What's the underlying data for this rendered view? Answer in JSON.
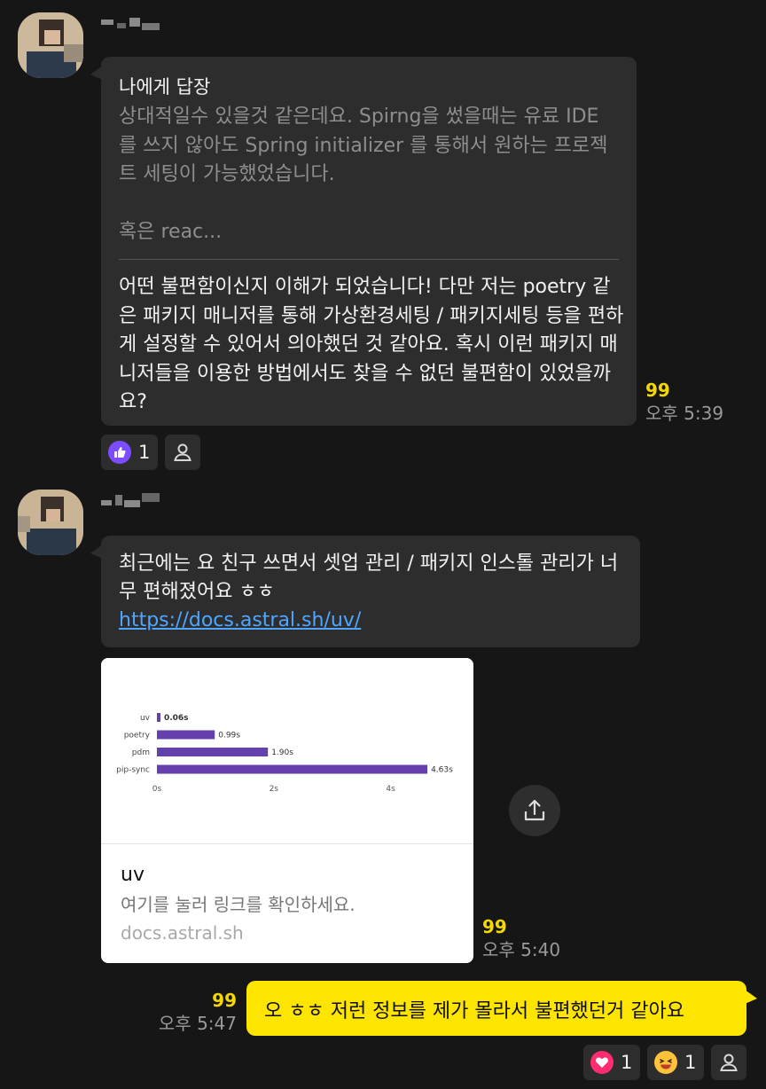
{
  "messages": [
    {
      "reply_title": "나에게 답장",
      "reply_quote": "상대적일수 있을것 같은데요. Spirng을 썼을때는 유료 IDE 를 쓰지 않아도 Spring initializer 를 통해서 원하는 프로젝트 세팅이 가능했었습니다.\n\n혹은 reac...",
      "text": "어떤 불편함이신지 이해가 되었습니다! 다만 저는 poetry 같은 패키지 매니저를 통해 가상환경세팅 / 패키지세팅 등을 편하게 설정할 수 있어서 의아했던 것 같아요. 혹시 이런 패키지 매니저들을 이용한 방법에서도 찾을 수 없던 불편함이 있었을까요?",
      "unread": "99",
      "time": "오후 5:39",
      "reaction_count": "1"
    },
    {
      "text": "최근에는 요 친구 쓰면서 셋업 관리 / 패키지 인스톨 관리가 너무 편해졌어요 ㅎㅎ",
      "link": "https://docs.astral.sh/uv/",
      "unread": "99",
      "time": "오후 5:40"
    },
    {
      "text": "오 ㅎㅎ 저런 정보를 제가 몰라서 불편했던거 같아요",
      "unread": "99",
      "time": "오후 5:47",
      "reactions": [
        {
          "icon": "heart-icon",
          "count": "1"
        },
        {
          "icon": "laugh-icon",
          "count": "1"
        }
      ]
    }
  ],
  "link_card": {
    "title": "uv",
    "description": "여기를 눌러 링크를 확인하세요.",
    "domain": "docs.astral.sh"
  },
  "chart_data": {
    "type": "bar",
    "categories": [
      "uv",
      "poetry",
      "pdm",
      "pip-sync"
    ],
    "values": [
      0.06,
      0.99,
      1.9,
      4.63
    ],
    "data_labels": [
      "0.06s",
      "0.99s",
      "1.90s",
      "4.63s"
    ],
    "xticks": [
      "0s",
      "2s",
      "4s"
    ],
    "xlim": [
      0,
      4.75
    ],
    "color": "#6340ac",
    "title": "",
    "xlabel": "",
    "ylabel": ""
  },
  "colors": {
    "background": "#161616",
    "bubble": "#2d2d2d",
    "my_bubble": "#fee500",
    "unread": "#f5d800",
    "link": "#4fa6ff",
    "thumb_badge": "#7c4dff",
    "heart_badge": "#ff2d6f"
  }
}
